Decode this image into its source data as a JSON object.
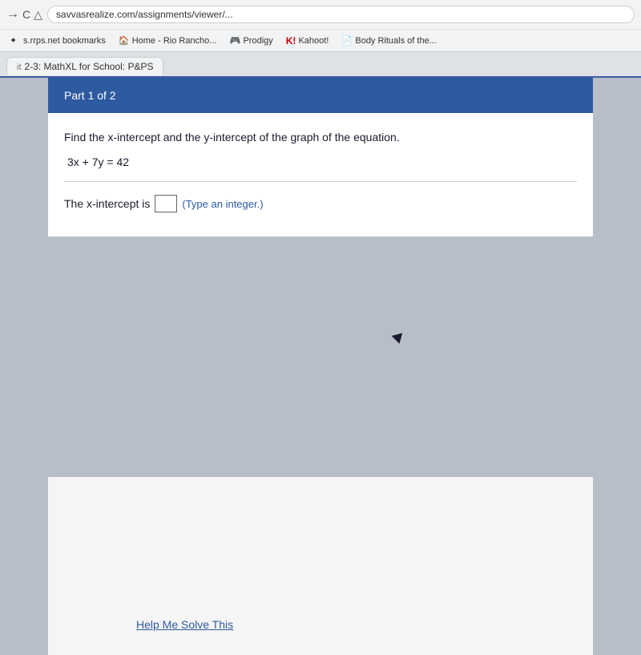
{
  "browser": {
    "nav": {
      "back": "←",
      "forward": "→",
      "reload": "↺",
      "home": "⌂"
    },
    "url": "savvasrealize.com/assignments/viewer/...",
    "bookmarks": [
      {
        "id": "rrps",
        "label": "s.rrps.net bookmarks",
        "icon": "star"
      },
      {
        "id": "home-rio",
        "label": "Home - Rio Rancho...",
        "icon": "house"
      },
      {
        "id": "prodigy",
        "label": "Prodigy",
        "icon": "game"
      },
      {
        "id": "kahoot",
        "label": "Kahoot!",
        "icon": "K"
      },
      {
        "id": "body-rituals",
        "label": "Body Rituals of the...",
        "icon": "doc"
      }
    ],
    "tab": {
      "prefix": "it",
      "label": "2-3: MathXL for School: P&PS"
    }
  },
  "question": {
    "part": "Part 1 of 2",
    "instruction": "Find the x-intercept and the y-intercept of the graph of the equation.",
    "equation": "3x + 7y = 42",
    "answer_label": "The x-intercept is",
    "answer_hint": "(Type an integer.)",
    "answer_value": ""
  },
  "help": {
    "label": "Help Me Solve This"
  }
}
